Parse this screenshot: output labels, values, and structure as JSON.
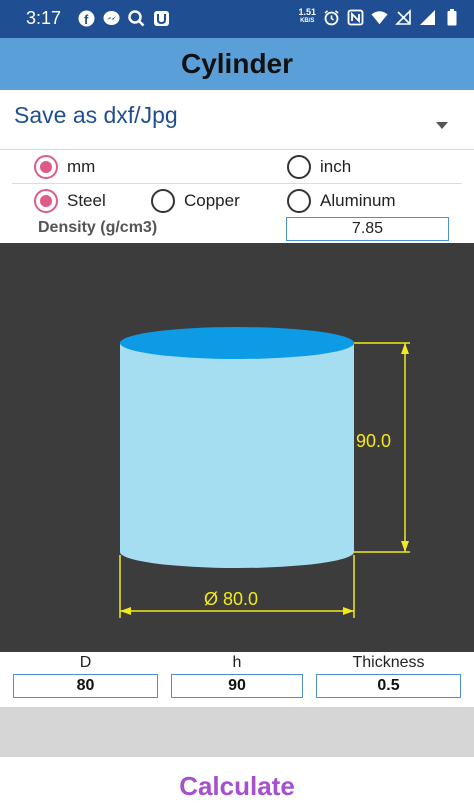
{
  "status_bar": {
    "time": "3:17",
    "net_speed": "1.51",
    "net_unit": "KB/S",
    "left_icons": [
      "facebook-icon",
      "messenger-icon",
      "search-app-icon",
      "app-icon"
    ],
    "right_icons": [
      "alarm-icon",
      "nfc-icon",
      "wifi-icon",
      "no-data-icon",
      "signal-icon",
      "battery-icon"
    ]
  },
  "app": {
    "title": "Cylinder"
  },
  "dropdown": {
    "value": "Save as dxf/Jpg"
  },
  "units": {
    "options": [
      {
        "label": "mm",
        "selected": true
      },
      {
        "label": "inch",
        "selected": false
      }
    ]
  },
  "materials": {
    "options": [
      {
        "label": "Steel",
        "selected": true
      },
      {
        "label": "Copper",
        "selected": false
      },
      {
        "label": "Aluminum",
        "selected": false
      }
    ]
  },
  "density": {
    "label": "Density (g/cm3)",
    "value": "7.85"
  },
  "drawing": {
    "height_label": "90.0",
    "diameter_label": "Ø 80.0",
    "colors": {
      "background": "#3c3c3c",
      "cylinder_body": "#a4def0",
      "cylinder_top": "#0d9be6",
      "dimension": "#f2ea1a"
    }
  },
  "dimensions": {
    "d_label": "D",
    "d_value": "80",
    "h_label": "h",
    "h_value": "90",
    "t_label": "Thickness",
    "t_value": "0.5"
  },
  "actions": {
    "calculate_label": "Calculate"
  },
  "colors": {
    "accent": "#e05a86",
    "title_bar": "#5b9fd8",
    "status_bar": "#1f4f92",
    "calculate": "#a64fcf"
  }
}
